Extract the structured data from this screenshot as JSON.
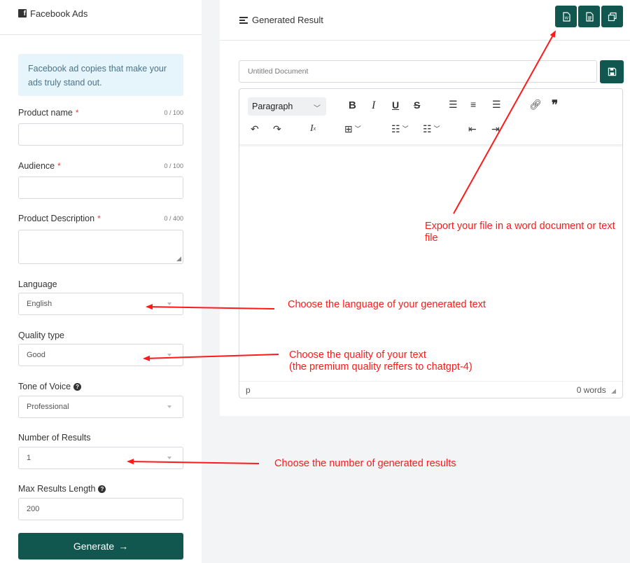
{
  "left": {
    "title": "Facebook Ads",
    "info": "Facebook ad copies that make your ads truly stand out.",
    "fields": {
      "product_name": {
        "label": "Product name",
        "required": "*",
        "count": "0 / 100",
        "value": ""
      },
      "audience": {
        "label": "Audience",
        "required": "*",
        "count": "0 / 100",
        "value": ""
      },
      "product_description": {
        "label": "Product Description",
        "required": "*",
        "count": "0 / 400",
        "value": ""
      },
      "language": {
        "label": "Language",
        "value": "English"
      },
      "quality": {
        "label": "Quality type",
        "value": "Good"
      },
      "tone": {
        "label": "Tone of Voice",
        "value": "Professional"
      },
      "results": {
        "label": "Number of Results",
        "value": "1"
      },
      "max_length": {
        "label": "Max Results Length",
        "value": "200"
      }
    },
    "generate_label": "Generate"
  },
  "right": {
    "title": "Generated Result",
    "header_buttons": [
      "word-export-icon",
      "text-export-icon",
      "copy-icon"
    ],
    "doc_title_placeholder": "Untitled Document",
    "editor": {
      "block_format": "Paragraph",
      "status_path": "p",
      "word_count": "0 words"
    }
  },
  "annotations": {
    "export": "Export your file in a word document or text file",
    "language": "Choose the language of your generated text",
    "quality_line1": "Choose the quality of your text",
    "quality_line2": "(the premium quality reffers to chatgpt-4)",
    "results": "Choose the number of generated results"
  },
  "colors": {
    "accent": "#11574f",
    "annotation": "#ff1a1a",
    "info_bg": "#e6f4fb"
  }
}
